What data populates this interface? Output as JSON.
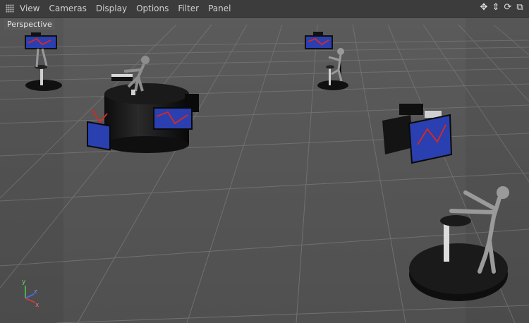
{
  "menubar": {
    "items": [
      "View",
      "Cameras",
      "Display",
      "Options",
      "Filter",
      "Panel"
    ]
  },
  "nav_icons": [
    "move-icon",
    "zoom-icon",
    "rotate-icon",
    "maximize-icon"
  ],
  "viewport": {
    "camera_label": "Perspective"
  },
  "axis": {
    "y": "y",
    "z": "z",
    "x": "x"
  },
  "colors": {
    "menubar_bg": "#3c3c3c",
    "viewport_bg": "#5a5a5a",
    "grid": "#6c6c6c",
    "object": "#111111",
    "screen": "#2a3fb0"
  }
}
